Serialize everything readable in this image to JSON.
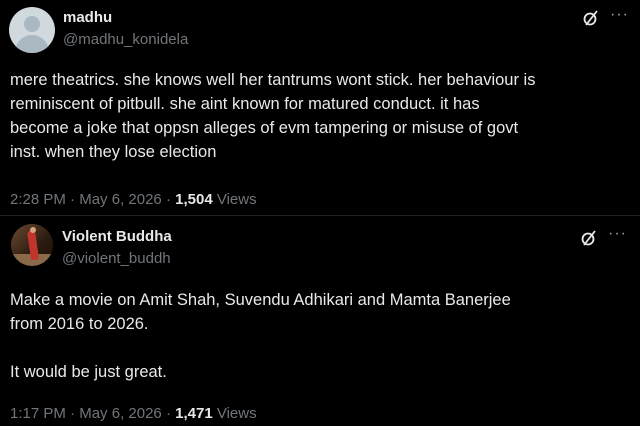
{
  "tweets": [
    {
      "name": "madhu",
      "handle": "@madhu_konidela",
      "text": "mere theatrics. she knows well her tantrums wont stick. her behaviour is\nreminiscent of pitbull. she aint known for matured conduct. it has\nbecome a joke that oppsn alleges of evm tampering or misuse of govt\ninst. when they lose election",
      "time": "2:28 PM",
      "date": "May 6, 2026",
      "views_count": "1,504",
      "views_label": "Views",
      "avatar": "default-avatar"
    },
    {
      "name": "Violent Buddha",
      "handle": "@violent_buddh",
      "text": "Make a movie on Amit Shah, Suvendu Adhikari and Mamta Banerjee\nfrom 2016 to 2026.\n\nIt would be just great.",
      "time": "1:17 PM",
      "date": "May 6, 2026",
      "views_count": "1,471",
      "views_label": "Views",
      "avatar": "photo-avatar"
    }
  ],
  "separator": "·",
  "more_glyph": "···",
  "icons": {
    "grok": "grok-icon",
    "more": "more-options-icon"
  },
  "colors": {
    "background": "#000000",
    "text": "#e7e9ea",
    "secondary": "#71767b"
  }
}
